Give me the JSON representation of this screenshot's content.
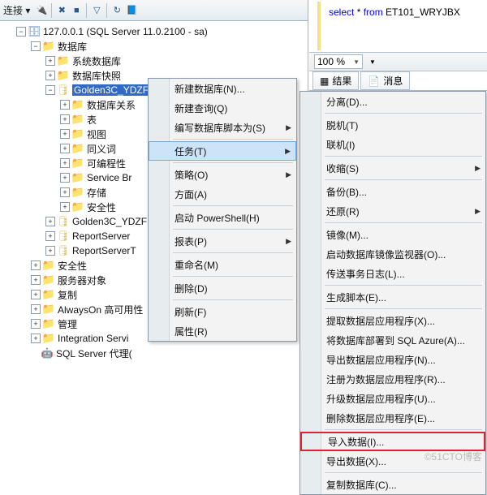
{
  "toolbar": {
    "label": "连接 ▾"
  },
  "server": {
    "label": "127.0.0.1 (SQL Server 11.0.2100 - sa)"
  },
  "tree": {
    "databases": "数据库",
    "sysdb": "系统数据库",
    "snapshots": "数据库快照",
    "seldb": "Golden3C_YDZF",
    "diagrams": "数据库关系",
    "tables": "表",
    "views": "视图",
    "synonyms": "同义词",
    "programmability": "可编程性",
    "servicebroker": "Service Br",
    "storage": "存储",
    "security_in": "安全性",
    "db2": "Golden3C_YDZF",
    "rpt": "ReportServer",
    "rptt": "ReportServerT",
    "security": "安全性",
    "serverobj": "服务器对象",
    "replication": "复制",
    "alwayson": "AlwaysOn 高可用性",
    "mgmt": "管理",
    "intsvc": "Integration Servi",
    "agent": "SQL Server 代理("
  },
  "sql": {
    "pre": "select",
    "mid": " * ",
    "from": "from",
    "post": " ET101_WRYJBX"
  },
  "zoom": "100 %",
  "tabs": {
    "results": "结果",
    "messages": "消息"
  },
  "menu1": {
    "newdb": "新建数据库(N)...",
    "newq": "新建查询(Q)",
    "script": "编写数据库脚本为(S)",
    "tasks": "任务(T)",
    "policies": "策略(O)",
    "facets": "方面(A)",
    "ps": "启动 PowerShell(H)",
    "reports": "报表(P)",
    "rename": "重命名(M)",
    "delete": "删除(D)",
    "refresh": "刷新(F)",
    "props": "属性(R)"
  },
  "menu2": {
    "detach": "分离(D)...",
    "offline": "脱机(T)",
    "online": "联机(I)",
    "shrink": "收缩(S)",
    "backup": "备份(B)...",
    "restore": "还原(R)",
    "mirror": "镜像(M)...",
    "mirrormon": "启动数据库镜像监视器(O)...",
    "shiplog": "传送事务日志(L)...",
    "genscript": "生成脚本(E)...",
    "extract": "提取数据层应用程序(X)...",
    "deployazure": "将数据库部署到 SQL Azure(A)...",
    "exportapp": "导出数据层应用程序(N)...",
    "registerapp": "注册为数据层应用程序(R)...",
    "upgradeapp": "升级数据层应用程序(U)...",
    "deleteapp": "删除数据层应用程序(E)...",
    "import": "导入数据(I)...",
    "export": "导出数据(X)...",
    "copydb": "复制数据库(C)..."
  },
  "watermark": "©51CTO博客"
}
